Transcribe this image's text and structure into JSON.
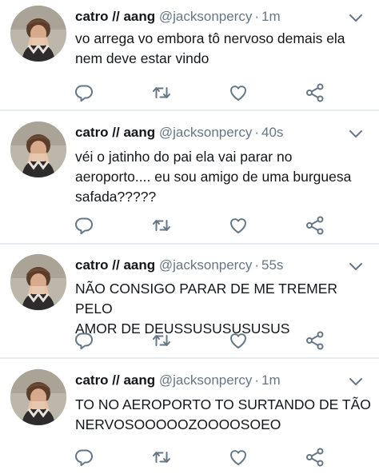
{
  "tweets": [
    {
      "name": "catro // aang",
      "handle": "@jacksonpercy",
      "separator": "·",
      "time": "1m",
      "text_lines": [
        "vo arrega vo embora tô nervoso demais ela",
        "nem deve estar vindo"
      ]
    },
    {
      "name": "catro // aang",
      "handle": "@jacksonpercy",
      "separator": "·",
      "time": "40s",
      "text_lines": [
        "véi o jatinho do pai ela vai parar no",
        "aeroporto.... eu sou amigo de uma burguesa",
        "safada?????"
      ]
    },
    {
      "name": "catro // aang",
      "handle": "@jacksonpercy",
      "separator": "·",
      "time": "55s",
      "text_lines": [
        "NÃO CONSIGO PARAR DE ME TREMER PELO",
        "AMOR DE DEUSSUSUSUSUSUS"
      ]
    },
    {
      "name": "catro // aang",
      "handle": "@jacksonpercy",
      "separator": "·",
      "time": "1m",
      "text_lines": [
        "TO NO AEROPORTO TO SURTANDO DE TÃO",
        "NERVOSOOOOOZOOOOSOEO"
      ]
    }
  ],
  "icons": {
    "reply": "reply-icon",
    "retweet": "retweet-icon",
    "like": "heart-icon",
    "share": "share-icon",
    "more": "chevron-down-icon"
  },
  "colors": {
    "text": "#14171a",
    "secondary": "#657786",
    "icon": "#657786",
    "divider": "#e6ecf0",
    "background": "#ffffff"
  }
}
